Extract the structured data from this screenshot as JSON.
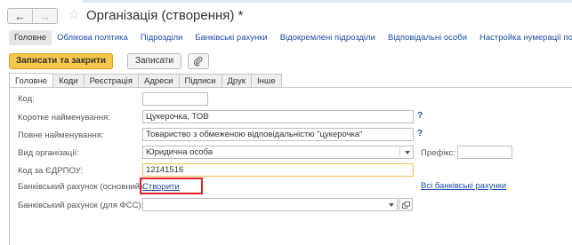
{
  "window": {
    "title": "Організація (створення) *"
  },
  "subnav": {
    "items": [
      {
        "label": "Головне",
        "active": true
      },
      {
        "label": "Облікова політика"
      },
      {
        "label": "Підрозділи"
      },
      {
        "label": "Банківські рахунки"
      },
      {
        "label": "Відокремлені підрозділи"
      },
      {
        "label": "Відповідальні особи"
      },
      {
        "label": "Настройка нумерації под"
      }
    ]
  },
  "toolbar": {
    "save_close_label": "Записати та закрити",
    "save_label": "Записати",
    "attach_icon": "paperclip-icon"
  },
  "tabs": [
    "Головне",
    "Коди",
    "Реєстрація",
    "Адреси",
    "Підписи",
    "Друк",
    "Інше"
  ],
  "form": {
    "code": {
      "label": "Код:",
      "value": ""
    },
    "short_name": {
      "label": "Коротке найменування:",
      "value": "Цукерочка, ТОВ",
      "help": "?"
    },
    "full_name": {
      "label": "Повне найменування:",
      "value": "Товариство з обмеженою відповідальністю \"цукерочка\"",
      "help": "?"
    },
    "org_type": {
      "label": "Вид організації:",
      "value": "Юридична особа"
    },
    "prefix": {
      "label": "Префікс:",
      "value": ""
    },
    "edrpou": {
      "label": "Код за ЄДРПОУ:",
      "value": "12141516"
    },
    "bank_main": {
      "label": "Банківський рахунок (основний):",
      "create_link": "Створити",
      "all_link": "Всі банківські рахунки"
    },
    "bank_fss": {
      "label": "Банківський рахунок (для ФСС):",
      "value": ""
    }
  },
  "colors": {
    "primary_button": "#f5c84d",
    "link": "#1f4fa8",
    "highlight_box": "#e02222",
    "focus_border": "#f0bd52"
  }
}
